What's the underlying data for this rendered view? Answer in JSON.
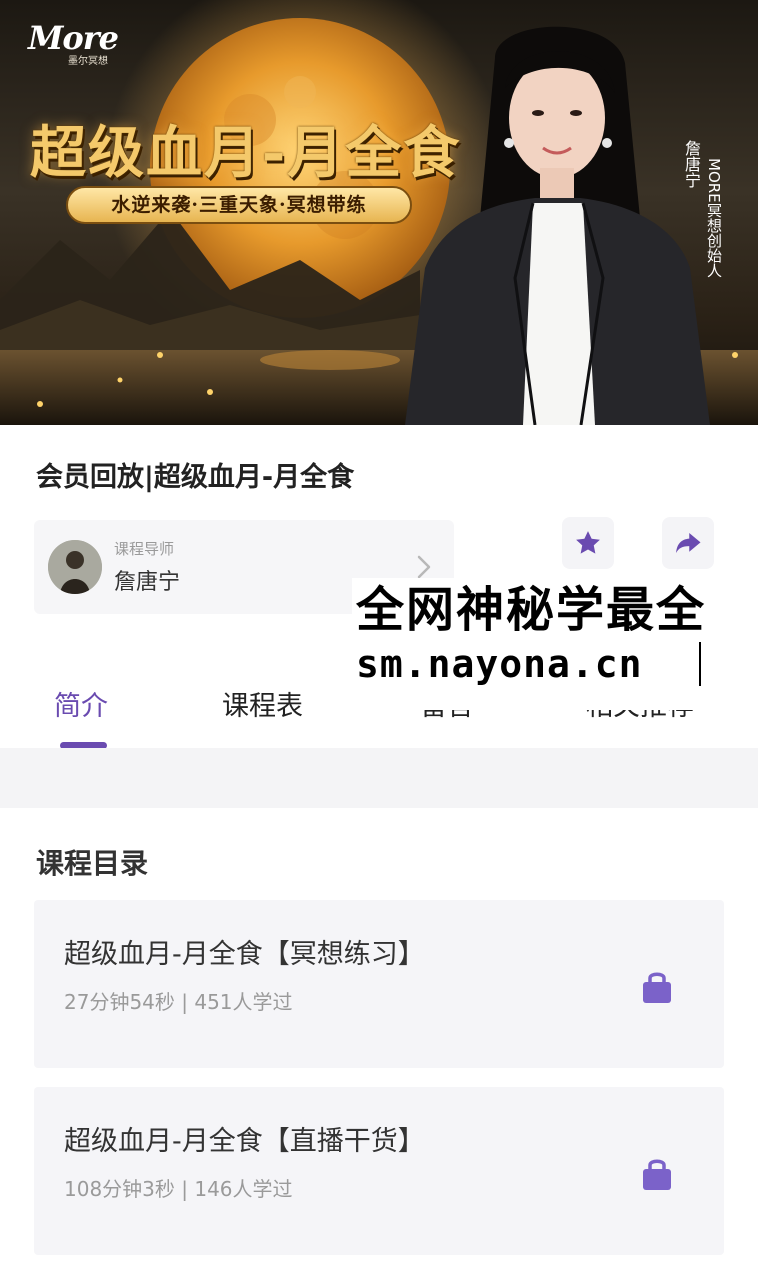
{
  "banner": {
    "brand": "More",
    "brand_sub": "墨尔冥想",
    "headline": "超级血月-月全食",
    "tagline": "水逆来袭·三重天象·冥想带练",
    "presenter_name": "詹唐宁",
    "presenter_title": "MORE冥想创始人"
  },
  "course": {
    "title": "会员回放|超级血月-月全食"
  },
  "teacher": {
    "label": "课程导师",
    "name": "詹唐宁"
  },
  "actions": {
    "favorite_icon": "star-icon",
    "share_icon": "share-icon"
  },
  "watermark": {
    "line1": "全网神秘学最全",
    "line2": "sm.nayona.cn"
  },
  "tabs": [
    {
      "label": "简介",
      "active": true
    },
    {
      "label": "课程表",
      "active": false
    },
    {
      "label": "留言",
      "active": false
    },
    {
      "label": "相关推荐",
      "active": false
    }
  ],
  "catalog": {
    "title": "课程目录",
    "lessons": [
      {
        "title": "超级血月-月全食【冥想练习】",
        "meta": "27分钟54秒 | 451人学过",
        "locked": true
      },
      {
        "title": "超级血月-月全食【直播干货】",
        "meta": "108分钟3秒 | 146人学过",
        "locked": true
      }
    ]
  },
  "colors": {
    "accent": "#6a4bb0",
    "lock": "#7b62c9",
    "banner_gold": "#f4c96b"
  }
}
